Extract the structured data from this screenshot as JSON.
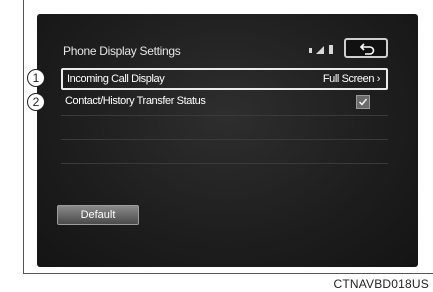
{
  "screen": {
    "title": "Phone Display Settings",
    "status_icons": [
      "bluetooth-icon",
      "signal-icon",
      "battery-icon"
    ],
    "back_icon": "return-arrow-icon"
  },
  "settings": [
    {
      "label": "Incoming Call Display",
      "value": "Full Screen ›",
      "selected": true
    },
    {
      "label": "Contact/History Transfer Status",
      "checked": true,
      "checkbox_icon": "checkmark-icon"
    }
  ],
  "default_button": "Default",
  "callouts": [
    "1",
    "2"
  ],
  "caption": "CTNAVBD018US"
}
